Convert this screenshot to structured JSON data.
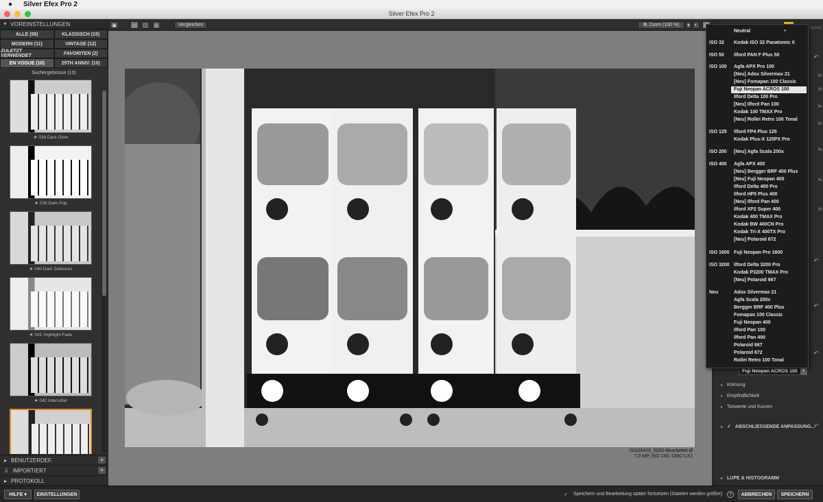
{
  "menubar": {
    "apple": "",
    "app_name": "Silver Efex Pro 2"
  },
  "window": {
    "title": "Silver Efex Pro 2"
  },
  "presets": {
    "header": "VOREINSTELLUNGEN",
    "categories": [
      {
        "label": "ALLE (58)"
      },
      {
        "label": "KLASSISCH (15)"
      },
      {
        "label": "MODERN (11)"
      },
      {
        "label": "VINTAGE (12)"
      },
      {
        "label": "ZULETZT VERWENDET"
      },
      {
        "label": "FAVORITEN (2)"
      },
      {
        "label": "EN VOGUE (10)"
      },
      {
        "label": "25TH ANNIV. (10)"
      }
    ],
    "search_results_title": "Suchergebnisse (10)",
    "items": [
      {
        "label": "★ 038 Dark Glow"
      },
      {
        "label": "★ 039 Dark Pop"
      },
      {
        "label": "★ 040 Dark Selenium"
      },
      {
        "label": "★ 041 Highlight Fade"
      },
      {
        "label": "★ 042 Intensifier"
      },
      {
        "label": ""
      }
    ]
  },
  "left_bottom": {
    "custom": "BENUTZERDEF.",
    "imported": "IMPORTIERT",
    "history": "PROTOKOLL",
    "plus": "+"
  },
  "toolbar": {
    "compare": "Vergleichen",
    "zoom": "Zoom (100 %)"
  },
  "image_info": {
    "filename": "20100419_5000-Bearbeitet.tif",
    "details": "7,0 MP, ISO 100, DMC-LX1"
  },
  "film_menu": {
    "selected": "Fuji Neopan ACROS 100",
    "items": [
      {
        "group": "",
        "label": "Neutral",
        "checked": "•"
      },
      {
        "group": "ISO 32",
        "label": "Kodak ISO 32 Panatomic X"
      },
      {
        "group": "ISO 50",
        "label": "Ilford PAN F Plus 50"
      },
      {
        "group": "ISO 100",
        "label": "Agfa APX Pro 100"
      },
      {
        "group": "",
        "label": "[Neu] Adox Silvermax 21"
      },
      {
        "group": "",
        "label": "[Neu] Fomapan 100 Classic"
      },
      {
        "group": "",
        "label": "Fuji Neopan ACROS 100"
      },
      {
        "group": "",
        "label": "Ilford Delta 100 Pro"
      },
      {
        "group": "",
        "label": "[Neu] Ilford Pan 100"
      },
      {
        "group": "",
        "label": "Kodak 100 TMAX Pro"
      },
      {
        "group": "",
        "label": "[Neu] Rollei Retro 100 Tonal"
      },
      {
        "group": "ISO 125",
        "label": "Ilford FP4 Plus 125"
      },
      {
        "group": "",
        "label": "Kodak Plus-X 125PX Pro"
      },
      {
        "group": "ISO 200",
        "label": "[Neu] Agfa Scala 200x"
      },
      {
        "group": "ISO 400",
        "label": "Agfa APX 400"
      },
      {
        "group": "",
        "label": "[Neu] Bergger BRF 400 Plus"
      },
      {
        "group": "",
        "label": "[Neu] Fuji Neopan 400"
      },
      {
        "group": "",
        "label": "Ilford Delta 400 Pro"
      },
      {
        "group": "",
        "label": "Ilford HP5 Plus 400"
      },
      {
        "group": "",
        "label": "[Neu] Ilford Pan 400"
      },
      {
        "group": "",
        "label": "Ilford XP2 Super 400"
      },
      {
        "group": "",
        "label": "Kodak 400 TMAX Pro"
      },
      {
        "group": "",
        "label": "Kodak BW 400CN Pro"
      },
      {
        "group": "",
        "label": "Kodak Tri-X 400TX Pro"
      },
      {
        "group": "",
        "label": "[Neu] Polaroid 672"
      },
      {
        "group": "ISO 1600",
        "label": "Fuji Neopan Pro 1600"
      },
      {
        "group": "ISO 3200",
        "label": "Ilford Delta 3200 Pro"
      },
      {
        "group": "",
        "label": "Kodak P3200 TMAX Pro"
      },
      {
        "group": "",
        "label": "[Neu] Polaroid 667"
      },
      {
        "group": "Neu",
        "label": "Adox Silvermax 21"
      },
      {
        "group": "",
        "label": "Agfa Scala 200x"
      },
      {
        "group": "",
        "label": "Bergger BRF 400 Plus"
      },
      {
        "group": "",
        "label": "Fomapan 100 Classic"
      },
      {
        "group": "",
        "label": "Fuji Neopan 400"
      },
      {
        "group": "",
        "label": "Ilford Pan 100"
      },
      {
        "group": "",
        "label": "Ilford Pan 400"
      },
      {
        "group": "",
        "label": "Polaroid 667"
      },
      {
        "group": "",
        "label": "Polaroid 672"
      },
      {
        "group": "",
        "label": "Rollei Retro 100 Tonal"
      }
    ]
  },
  "right_panel": {
    "brand": "by DxO",
    "percents": [
      "%",
      "%",
      "%",
      "%",
      "%",
      "%",
      "%"
    ],
    "grain": "Körnung",
    "sensitivity": "Empfindlichkeit",
    "tone_curves": "Tonwerte und Kurven",
    "finishing": "ABSCHLIESSENDE ANPASSUNG...",
    "loupe": "LUPE & HISTOGRAMM",
    "check": "✓"
  },
  "bottom": {
    "help": "HILFE ▾",
    "settings": "EINSTELLUNGEN",
    "save_later": "Speichern und Bearbeitung später fortsetzen (Dateien werden größer)",
    "check": "✓",
    "question": "?",
    "cancel": "ABBRECHEN",
    "save": "SPEICHERN"
  },
  "colors": {
    "accent_orange": "#e48a1f",
    "panel": "#303030",
    "canvas": "#7e7e7e",
    "traffic_red": "#ff5f57",
    "traffic_yellow": "#febc2e",
    "traffic_green": "#28c840"
  }
}
